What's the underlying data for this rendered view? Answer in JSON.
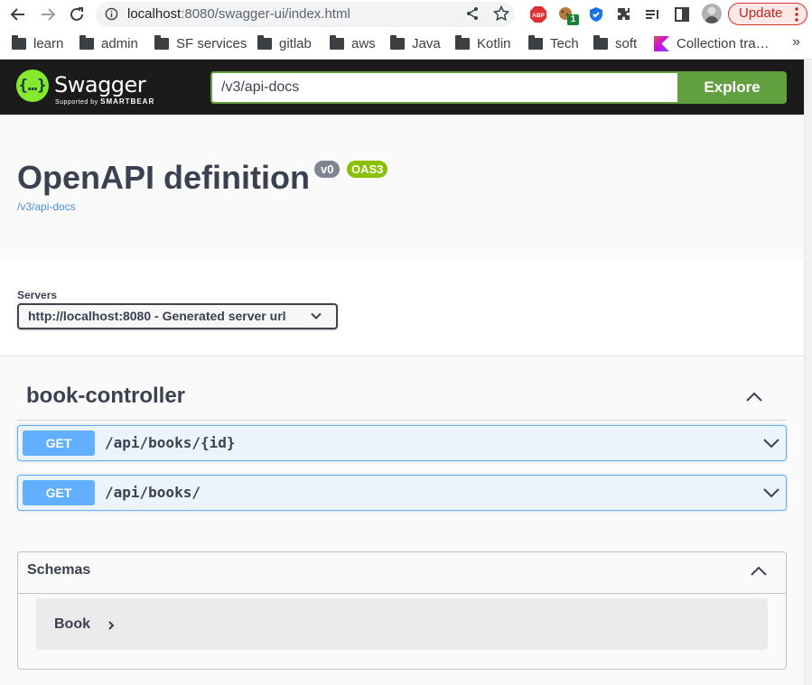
{
  "browser": {
    "url": {
      "host": "localhost",
      "rest": ":8080/swagger-ui/index.html"
    },
    "update_label": "Update",
    "extensions": [
      "abp-icon",
      "cookie-extension-icon",
      "shield-extension-icon",
      "puzzle-extensions-icon",
      "reading-list-icon",
      "side-panel-icon",
      "profile-avatar"
    ],
    "badge_count": "1",
    "bookmarks": [
      {
        "label": "learn",
        "icon": "folder-icon"
      },
      {
        "label": "admin",
        "icon": "folder-icon"
      },
      {
        "label": "SF services",
        "icon": "folder-icon"
      },
      {
        "label": "gitlab",
        "icon": "folder-icon"
      },
      {
        "label": "aws",
        "icon": "folder-icon"
      },
      {
        "label": "Java",
        "icon": "folder-icon"
      },
      {
        "label": "Kotlin",
        "icon": "folder-icon"
      },
      {
        "label": "Tech",
        "icon": "folder-icon"
      },
      {
        "label": "soft",
        "icon": "folder-icon"
      },
      {
        "label": "Collection tra…",
        "icon": "kotlin-icon"
      }
    ],
    "more_bookmarks": "»"
  },
  "swagger": {
    "logo_glyph": "{…}",
    "logo_name": "Swagger",
    "logo_sub_prefix": "Supported by",
    "logo_sub_brand": "SMARTBEAR",
    "spec_url": "/v3/api-docs",
    "explore_label": "Explore",
    "brand_color": "#85ea2d"
  },
  "info": {
    "title": "OpenAPI definition",
    "version": "v0",
    "oas": "OAS3",
    "link": "/v3/api-docs"
  },
  "servers": {
    "label": "Servers",
    "selected": "http://localhost:8080 - Generated server url"
  },
  "tag": {
    "name": "book-controller",
    "operations": [
      {
        "method": "GET",
        "path": "/api/books/{id}"
      },
      {
        "method": "GET",
        "path": "/api/books/"
      }
    ]
  },
  "schemas": {
    "title": "Schemas",
    "models": [
      {
        "name": "Book"
      }
    ]
  },
  "colors": {
    "get": "#61affe",
    "get_bg": "#ebf3fb",
    "explore": "#62a03f",
    "oas_badge": "#89bf04",
    "text": "#3b4151"
  }
}
